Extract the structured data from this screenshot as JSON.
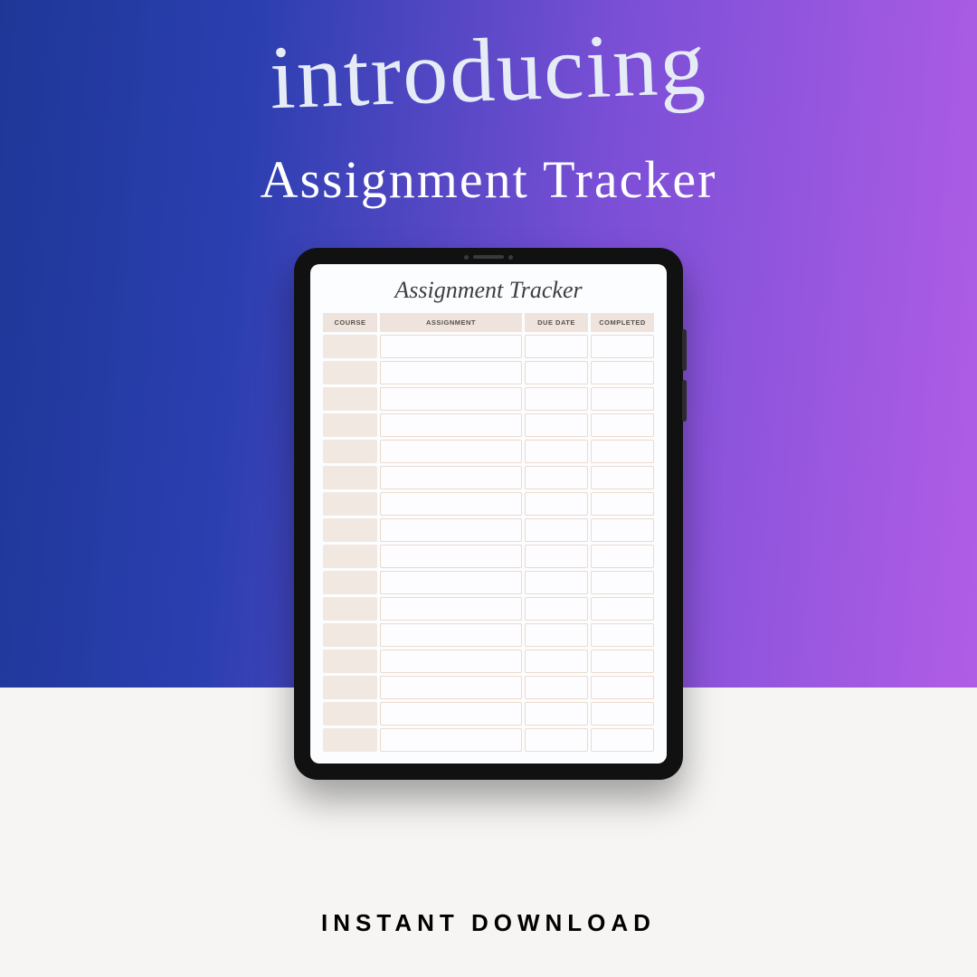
{
  "hero": {
    "script_label": "introducing",
    "title": "Assignment Tracker"
  },
  "tablet": {
    "tracker_title": "Assignment Tracker",
    "columns": {
      "course": "COURSE",
      "assignment": "ASSIGNMENT",
      "due_date": "DUE DATE",
      "completed": "COMPLETED"
    },
    "row_count": 16
  },
  "footer": {
    "cta": "INSTANT DOWNLOAD"
  },
  "colors": {
    "gradient_start": "#1e3797",
    "gradient_end": "#b15de6",
    "footer_bg": "#f6f5f3",
    "cell_tint": "#efe4dd"
  }
}
